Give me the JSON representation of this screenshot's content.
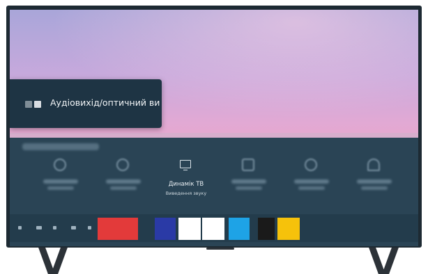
{
  "popup": {
    "label": "Аудіовихід/оптичний ви"
  },
  "sound_output": {
    "active_tile": {
      "name": "Динамік ТВ",
      "subtitle": "Виведення звуку"
    }
  },
  "apps_row": {
    "tile_colors": [
      "#e33a3a",
      "#2a3aa6",
      "#ffffff",
      "#ffffff",
      "#1ea3e6",
      "#1a1a1a",
      "#f6c20b"
    ]
  },
  "colors": {
    "frame": "#1d2a33",
    "panel": "#2a4455",
    "popup": "#1e3444"
  }
}
